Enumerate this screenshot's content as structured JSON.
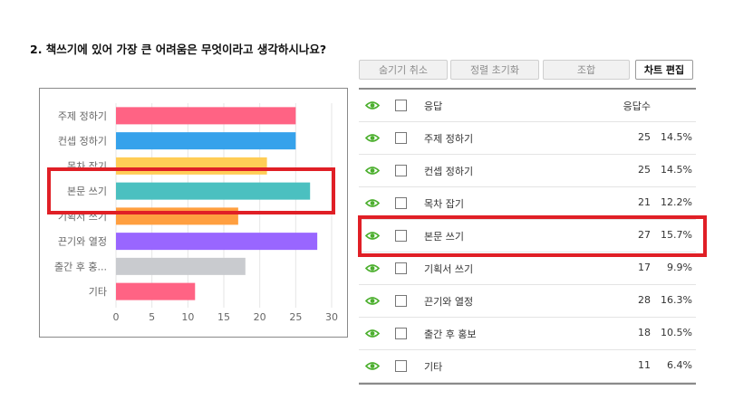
{
  "question": "2. 책쓰기에 있어 가장 큰 어려움은 무엇이라고 생각하시나요?",
  "toolbar": {
    "hide_cancel": "숨기기 취소",
    "sort_reset": "정렬 초기화",
    "combine": "조합",
    "edit_chart": "차트 편집"
  },
  "table": {
    "header_response": "응답",
    "header_count": "응답수",
    "rows": [
      {
        "label": "주제 정하기",
        "count": "25",
        "pct": "14.5%"
      },
      {
        "label": "컨셉 정하기",
        "count": "25",
        "pct": "14.5%"
      },
      {
        "label": "목차 잡기",
        "count": "21",
        "pct": "12.2%"
      },
      {
        "label": "본문 쓰기",
        "count": "27",
        "pct": "15.7%"
      },
      {
        "label": "기획서 쓰기",
        "count": "17",
        "pct": "9.9%"
      },
      {
        "label": "끈기와 열정",
        "count": "28",
        "pct": "16.3%"
      },
      {
        "label": "출간 후 홍보",
        "count": "18",
        "pct": "10.5%"
      },
      {
        "label": "기타",
        "count": "11",
        "pct": "6.4%"
      }
    ]
  },
  "colors": {
    "eye_icon": "#4caf2e",
    "highlight": "#e01f26"
  },
  "chart_data": {
    "type": "bar",
    "orientation": "horizontal",
    "categories": [
      "주제 정하기",
      "컨셉 정하기",
      "목차 잡기",
      "본문 쓰기",
      "기획서 쓰기",
      "끈기와 열정",
      "출간 후 홍...",
      "기타"
    ],
    "values": [
      25,
      25,
      21,
      27,
      17,
      28,
      18,
      11
    ],
    "colors": [
      "#ff6384",
      "#36a2eb",
      "#ffcd56",
      "#4bc0c0",
      "#ff9f40",
      "#9966ff",
      "#c9cbcf",
      "#ff6384"
    ],
    "xlim": [
      0,
      30
    ],
    "xticks": [
      "0",
      "5",
      "10",
      "15",
      "20",
      "25",
      "30"
    ],
    "grid": true,
    "title": "",
    "xlabel": "",
    "ylabel": ""
  }
}
